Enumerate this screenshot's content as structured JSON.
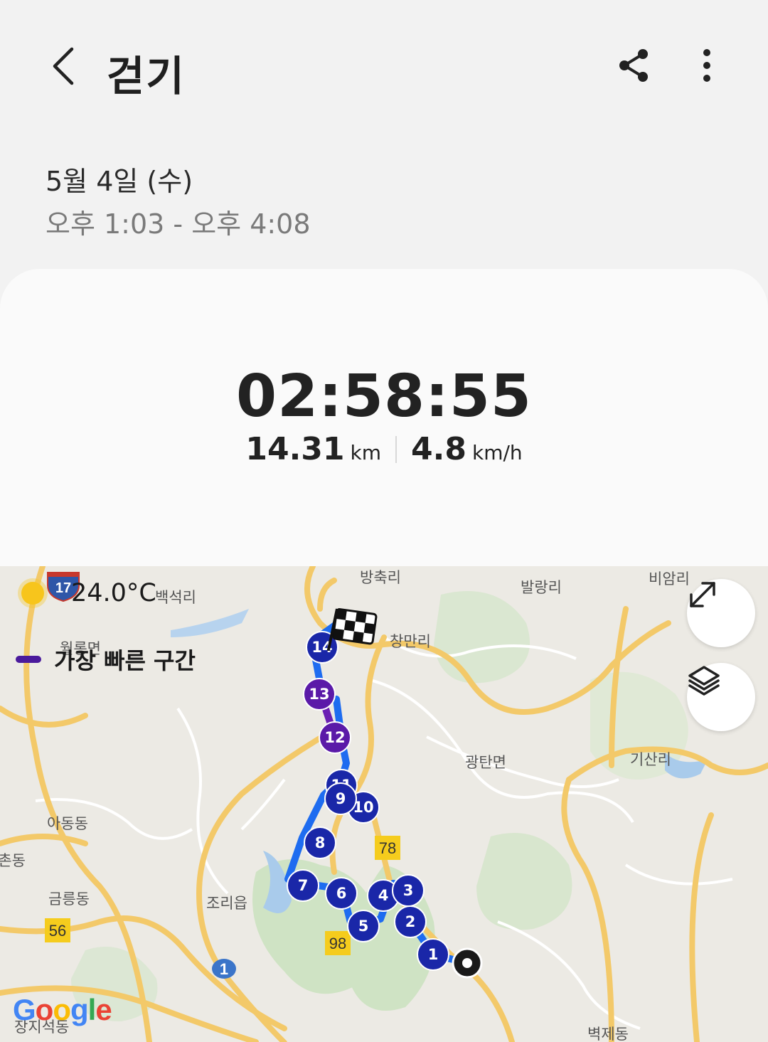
{
  "header": {
    "title": "걷기"
  },
  "session": {
    "date": "5월 4일 (수)",
    "time_range": "오후 1:03 - 오후 4:08"
  },
  "stats": {
    "duration": "02:58:55",
    "distance_value": "14.31",
    "distance_unit": "km",
    "speed_value": "4.8",
    "speed_unit": "km/h"
  },
  "map": {
    "temperature": "24.0°C",
    "legend_label": "가장 빠른 구간",
    "google": "Google",
    "places": [
      "방축리",
      "백석리",
      "발랑리",
      "비암리",
      "창만리",
      "월롱면",
      "광탄면",
      "기산리",
      "아동동",
      "금릉동",
      "조리읍",
      "벽제동",
      "금촌동",
      "장지석동"
    ],
    "road_numbers": [
      "17",
      "78",
      "56",
      "98",
      "1"
    ],
    "markers": [
      "1",
      "2",
      "3",
      "4",
      "5",
      "6",
      "7",
      "8",
      "9",
      "10",
      "11",
      "12",
      "13",
      "14"
    ],
    "colors": {
      "route": "#1e6cf0",
      "fast_segment": "#6b1fb3",
      "marker": "#1a27a8",
      "marker_fast": "#5b1aa8"
    }
  }
}
